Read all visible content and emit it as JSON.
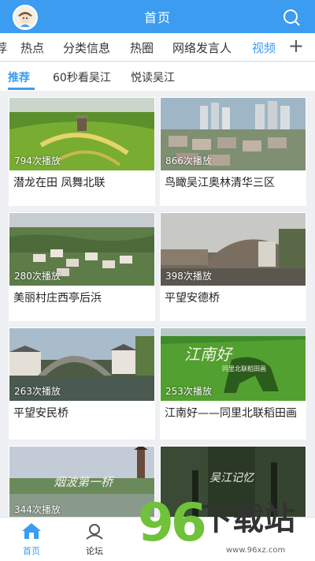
{
  "header": {
    "title": "首页"
  },
  "channels": [
    {
      "label": "荐"
    },
    {
      "label": "热点"
    },
    {
      "label": "分类信息"
    },
    {
      "label": "热圈"
    },
    {
      "label": "网络发言人"
    },
    {
      "label": "视频"
    }
  ],
  "channels_more": "+",
  "subtabs": [
    {
      "label": "推荐"
    },
    {
      "label": "60秒看吴江"
    },
    {
      "label": "悦读吴江"
    }
  ],
  "videos": [
    {
      "plays": "794次播放",
      "title": "潜龙在田 凤舞北联"
    },
    {
      "plays": "866次播放",
      "title": "鸟瞰吴江奥林清华三区"
    },
    {
      "plays": "280次播放",
      "title": "美丽村庄西亭后浜"
    },
    {
      "plays": "398次播放",
      "title": "平望安德桥"
    },
    {
      "plays": "263次播放",
      "title": "平望安民桥"
    },
    {
      "plays": "253次播放",
      "title": "江南好——同里北联稻田画"
    },
    {
      "plays": "344次播放",
      "title": ""
    },
    {
      "plays": "",
      "title": ""
    }
  ],
  "thumb_overlays": {
    "jiangnan": "江南好",
    "jiangnan_sub": "同里北联稻田画",
    "tongli": "烟波第一桥",
    "memory": "吴江记忆"
  },
  "bottom_nav": [
    {
      "label": "首页"
    },
    {
      "label": "论坛"
    }
  ],
  "watermark": {
    "digits": "96",
    "text": "下载站",
    "url": "www.96xz.com"
  },
  "colors": {
    "accent": "#3c9cf0",
    "watermark_green": "#6fc23a"
  }
}
